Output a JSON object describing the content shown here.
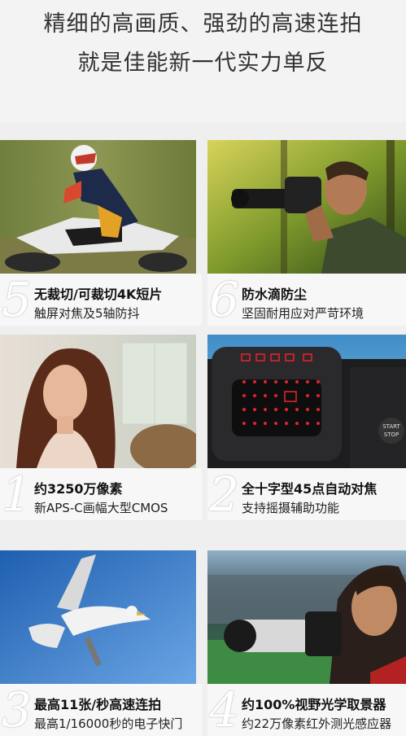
{
  "headline": {
    "line1": "精细的高画质、强劲的高速连拍",
    "line2": "就是佳能新一代实力单反"
  },
  "features": [
    {
      "num": "5",
      "title": "无裁切/可裁切4K短片",
      "subtitle": "触屏对焦及5轴防抖",
      "image": "motocross-rider-photo"
    },
    {
      "num": "6",
      "title": "防水滴防尘",
      "subtitle": "坚固耐用应对严苛环境",
      "image": "photographer-in-forest-photo"
    },
    {
      "num": "1",
      "title": "约3250万像素",
      "subtitle": "新APS-C画幅大型CMOS",
      "image": "portrait-woman-photo"
    },
    {
      "num": "2",
      "title": "全十字型45点自动对焦",
      "subtitle": "支持摇摄辅助功能",
      "image": "viewfinder-af-points-photo"
    },
    {
      "num": "3",
      "title": "最高11张/秒高速连拍",
      "subtitle": "最高1/16000秒的电子快门",
      "image": "seagull-flight-photo"
    },
    {
      "num": "4",
      "title": "约100%视野光学取景器",
      "subtitle": "约22万像素红外测光感应器",
      "image": "stadium-photographer-photo"
    }
  ],
  "viewfinder_labels": {
    "start": "START",
    "stop": "STOP"
  }
}
